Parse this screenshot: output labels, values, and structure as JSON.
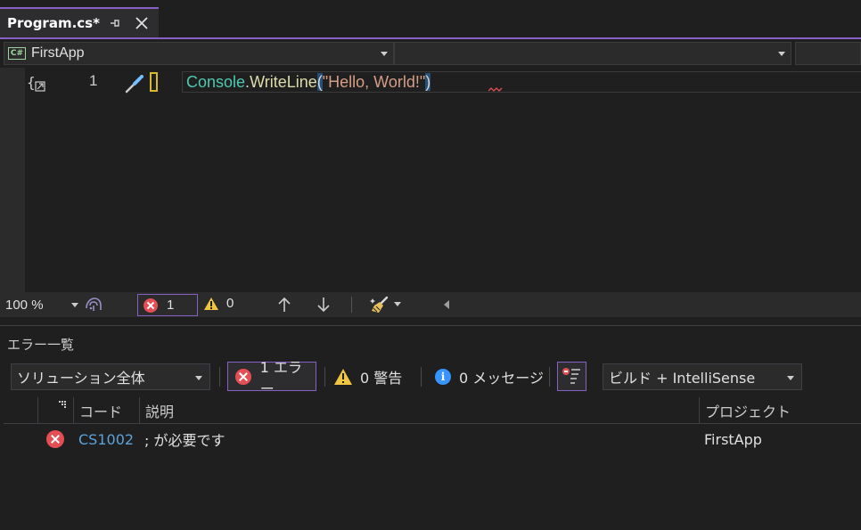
{
  "tab": {
    "title": "Program.cs*"
  },
  "nav": {
    "project": "FirstApp",
    "project_badge": "C#"
  },
  "editor": {
    "line_number": "1",
    "code": {
      "class": "Console",
      "dot": ".",
      "method": "WriteLine",
      "open_paren": "(",
      "string": "\"Hello, World!\"",
      "close_paren": ")"
    }
  },
  "status": {
    "zoom": "100 %",
    "error_count": "1",
    "warning_count": "0"
  },
  "error_list": {
    "title": "エラー一覧",
    "scope": "ソリューション全体",
    "errors_label": "1 エラー",
    "warnings_label": "0 警告",
    "messages_label": "0 メッセージ",
    "build_source": "ビルド + IntelliSense",
    "columns": {
      "code": "コード",
      "description": "説明",
      "project": "プロジェクト"
    },
    "rows": [
      {
        "code": "CS1002",
        "description": "; が必要です",
        "project": "FirstApp"
      }
    ]
  },
  "colors": {
    "accent": "#8661c5",
    "error": "#e34f55",
    "warning": "#f0c542",
    "info": "#3794ff"
  }
}
